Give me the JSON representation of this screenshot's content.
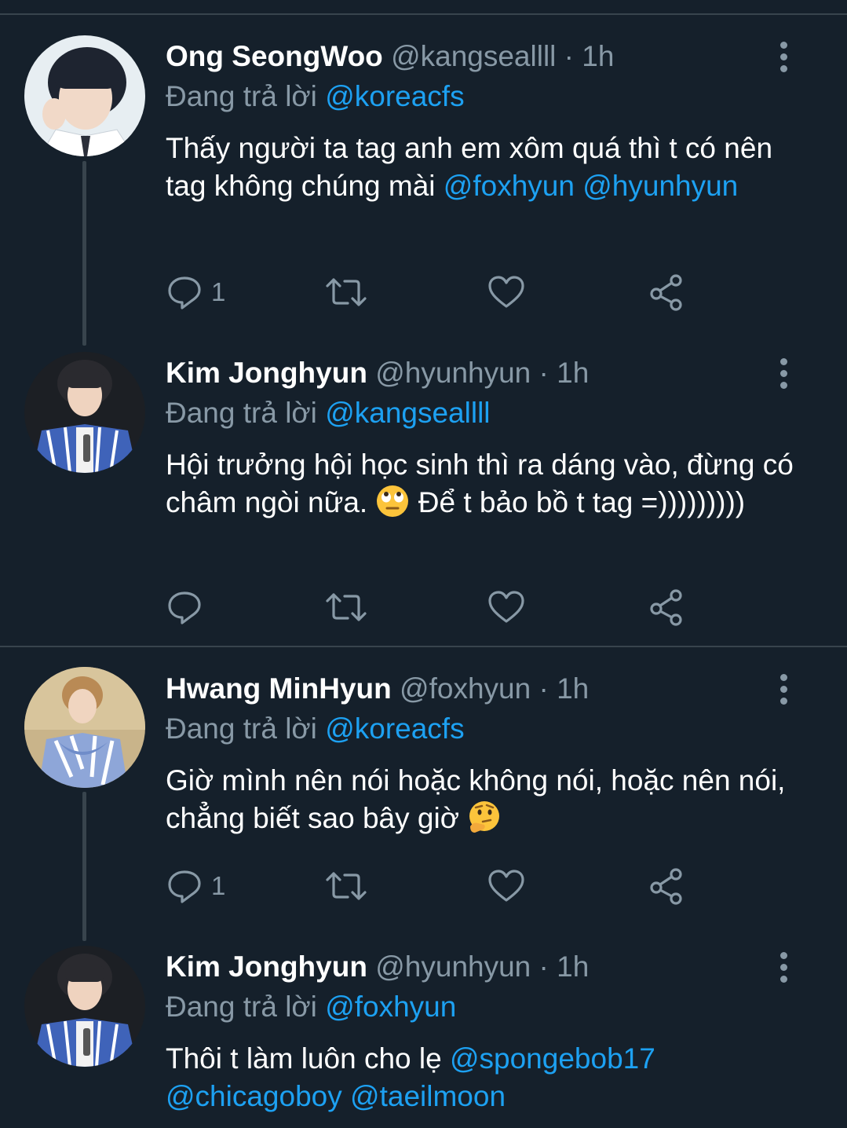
{
  "tweets": [
    {
      "name": "Ong SeongWoo",
      "meta": "@kangseallll · 1h",
      "reply_label": "Đang trả lời",
      "reply_to": "@koreacfs",
      "text_parts": [
        "Thấy người ta tag anh em xôm quá thì t có nên tag không chúng mài ",
        "@foxhyun",
        " ",
        "@hyunhyun"
      ],
      "reply_count": "1",
      "avatar": "ong-seongwoo-photo"
    },
    {
      "name": "Kim Jonghyun",
      "meta": "@hyunhyun · 1h",
      "reply_label": "Đang trả lời",
      "reply_to": "@kangseallll",
      "text_parts": [
        "Hội trưởng hội học sinh thì ra dáng vào, đừng có châm ngòi nữa. ",
        " Để t bảo bồ t tag =)))))))))"
      ],
      "emoji": "face-with-rolling-eyes",
      "reply_count": "",
      "avatar": "kim-jonghyun-photo"
    },
    {
      "name": "Hwang MinHyun",
      "meta": "@foxhyun · 1h",
      "reply_label": "Đang trả lời",
      "reply_to": "@koreacfs",
      "text_parts": [
        "Giờ mình nên nói hoặc không nói, hoặc nên nói, chẳng biết sao bây giờ "
      ],
      "emoji": "thinking-face",
      "reply_count": "1",
      "avatar": "hwang-minhyun-photo"
    },
    {
      "name": "Kim Jonghyun",
      "meta": "@hyunhyun · 1h",
      "reply_label": "Đang trả lời",
      "reply_to": "@foxhyun",
      "text_parts": [
        "Thôi t làm luôn cho lẹ ",
        "@spongebob17",
        " ",
        "@chicagoboy",
        " ",
        "@taeilmoon"
      ],
      "avatar": "kim-jonghyun-photo"
    }
  ],
  "colors": {
    "background": "#15202b",
    "text": "#ffffff",
    "muted": "#8899a6",
    "link": "#1da1f2",
    "divider": "#38444d"
  },
  "icons": [
    "reply-icon",
    "retweet-icon",
    "like-icon",
    "share-icon",
    "more-icon"
  ]
}
